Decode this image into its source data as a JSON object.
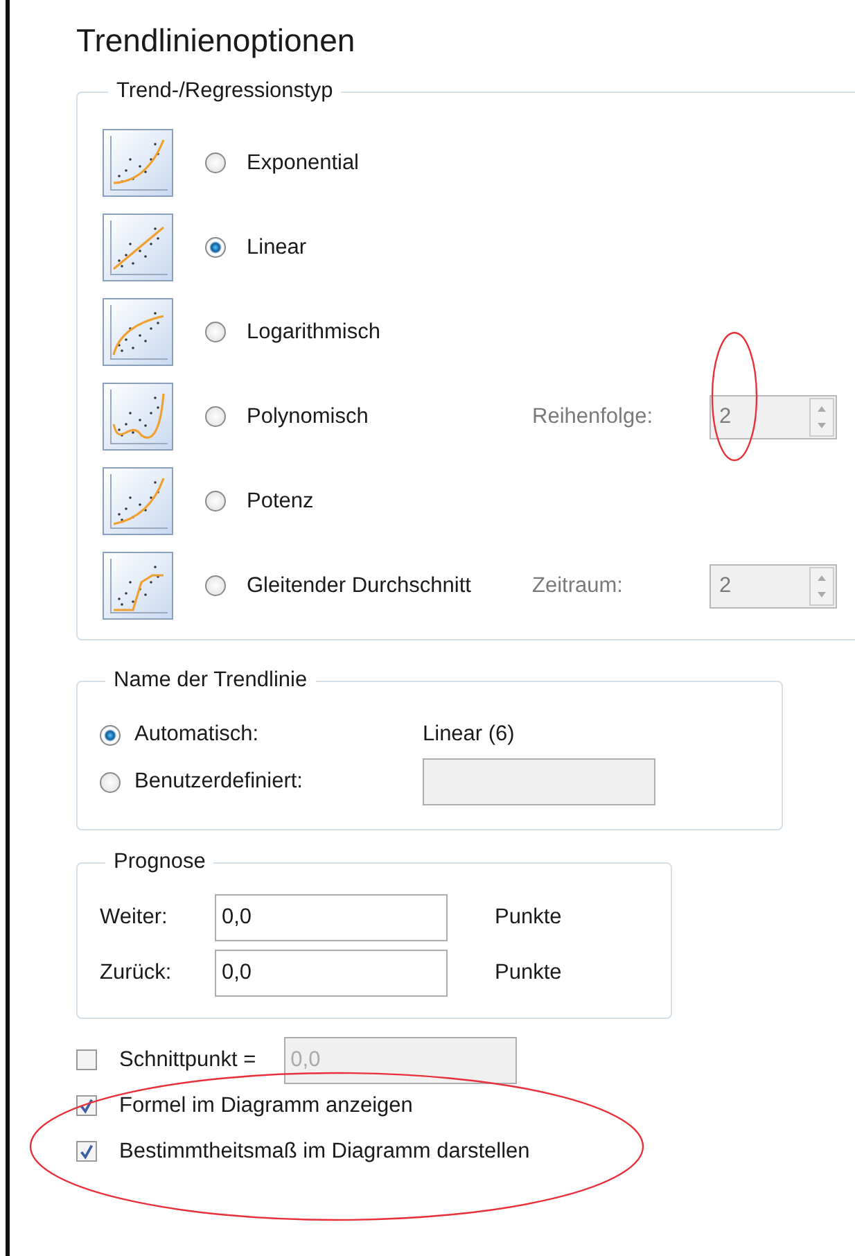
{
  "title": "Trendlinienoptionen",
  "trend_type": {
    "label": "Trend-/Regressionstyp",
    "options": [
      {
        "kind": "exponential",
        "label": "Exponential",
        "selected": false
      },
      {
        "kind": "linear",
        "label": "Linear",
        "selected": true
      },
      {
        "kind": "logarithmic",
        "label": "Logarithmisch",
        "selected": false
      },
      {
        "kind": "polynomial",
        "label": "Polynomisch",
        "selected": false,
        "parameter": {
          "label": "Reihenfolge:",
          "value": "2",
          "disabled": true
        }
      },
      {
        "kind": "power",
        "label": "Potenz",
        "selected": false
      },
      {
        "kind": "moving_average",
        "label": "Gleitender Durchschnitt",
        "selected": false,
        "parameter": {
          "label": "Zeitraum:",
          "value": "2",
          "disabled": true
        }
      }
    ]
  },
  "name_group": {
    "label": "Name der Trendlinie",
    "options": [
      {
        "kind": "text",
        "label": "Automatisch:",
        "selected": true,
        "value": "Linear (6)"
      },
      {
        "kind": "field",
        "label": "Benutzerdefiniert:",
        "selected": false,
        "disabled": true
      }
    ]
  },
  "forecast": {
    "label": "Prognose",
    "rows": [
      {
        "label": "Weiter:",
        "value": "0,0",
        "unit": "Punkte"
      },
      {
        "label": "Zurück:",
        "value": "0,0",
        "unit": "Punkte"
      }
    ]
  },
  "options": [
    {
      "label": "Schnittpunkt =",
      "checked": false,
      "field": {
        "value": "0,0",
        "disabled": true
      }
    },
    {
      "label": "Formel im Diagramm anzeigen",
      "checked": true
    },
    {
      "label": "Bestimmtheitsmaß im Diagramm darstellen",
      "checked": true
    }
  ]
}
